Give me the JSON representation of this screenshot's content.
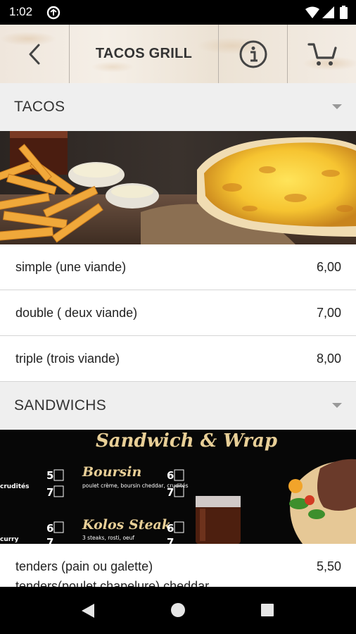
{
  "status_bar": {
    "time": "1:02"
  },
  "header": {
    "title": "TACOS GRILL"
  },
  "sections": [
    {
      "label": "TACOS",
      "items": [
        {
          "name": "simple (une viande)",
          "price": "6,00"
        },
        {
          "name": "double ( deux viande)",
          "price": "7,00"
        },
        {
          "name": "triple (trois viande)",
          "price": "8,00"
        }
      ]
    },
    {
      "label": "SANDWICHS",
      "banner": {
        "heading": "Sandwich & Wrap",
        "left_top_text": "crudités",
        "left_bottom_text": "curry",
        "price_left_1": "5",
        "price_left_2": "7",
        "price_left_3": "6",
        "price_left_4": "7",
        "product_1_name": "Boursin",
        "product_1_desc": "poulet crème, boursin cheddar, crudités",
        "product_1_price_1": "6",
        "product_1_price_2": "7",
        "product_2_name": "Kolos Steak",
        "product_2_desc": "3 steaks, rosti, oeuf",
        "product_2_price_1": "6",
        "product_2_price_2": "7"
      },
      "items": [
        {
          "name": "tenders (pain ou galette)",
          "price": "5,50"
        },
        {
          "name": "tenders(poulet chapelure) cheddar",
          "price": ""
        }
      ]
    }
  ],
  "colors": {
    "status_bar": "#000000",
    "section_bg": "#efefef",
    "nav_bar": "#000000",
    "banner_gold": "#e8cf97"
  }
}
